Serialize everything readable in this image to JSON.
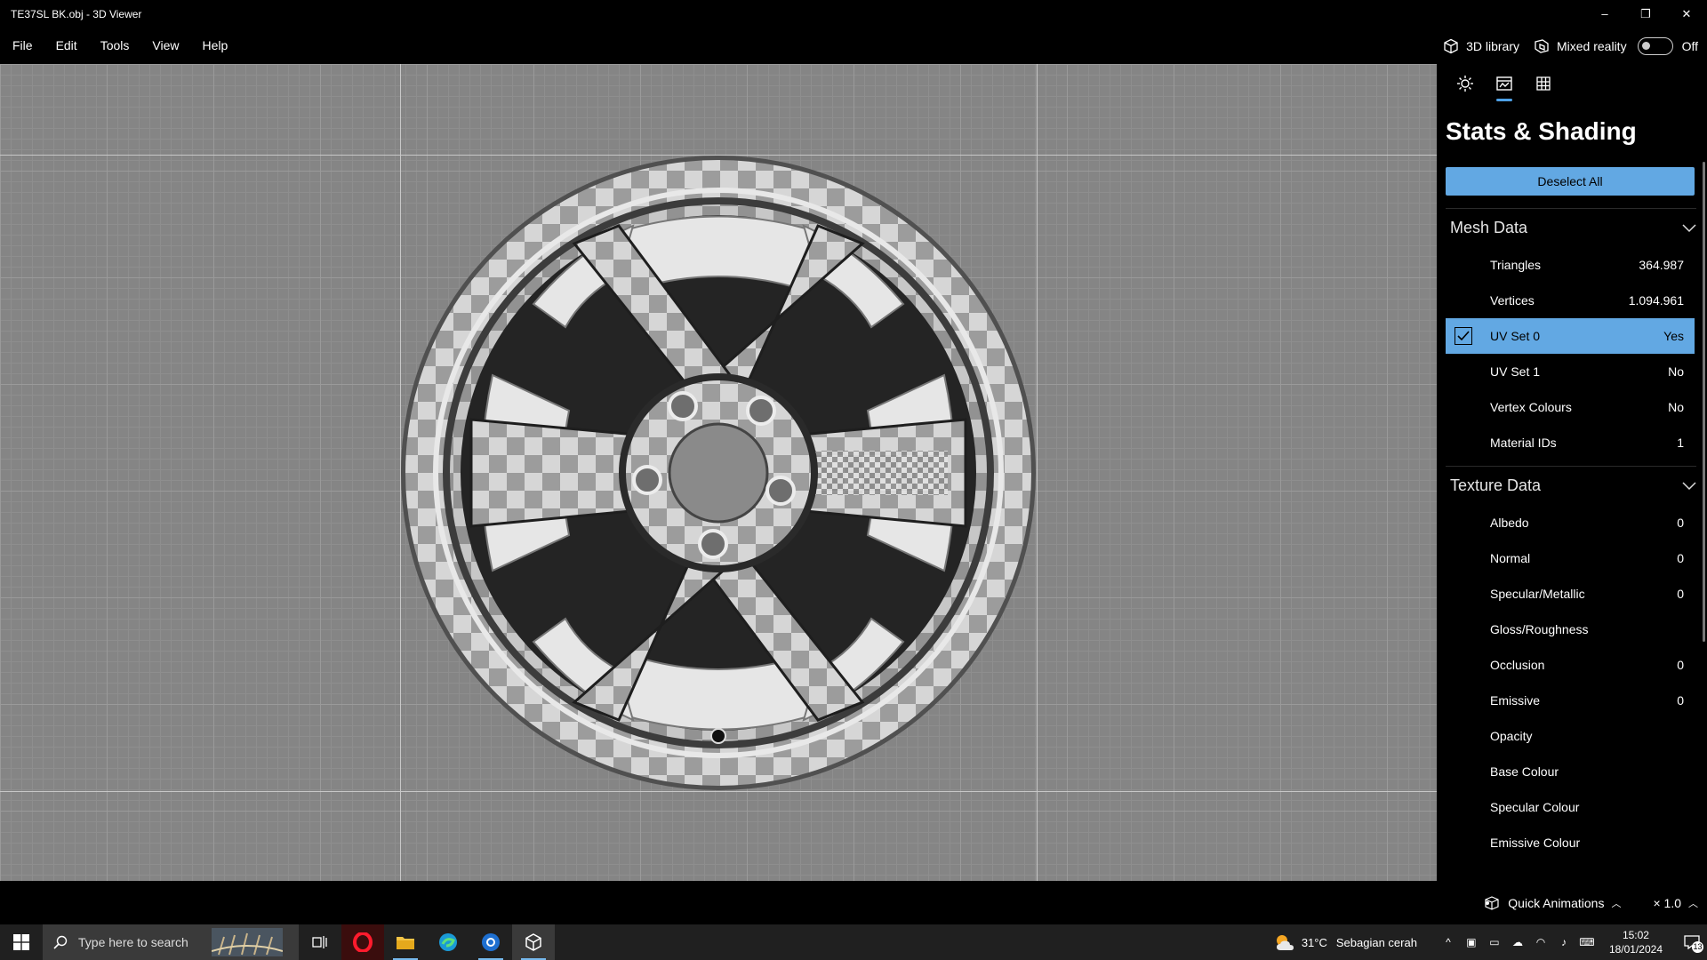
{
  "window": {
    "title": "TE37SL BK.obj - 3D Viewer",
    "controls": {
      "minimize": "–",
      "restore": "❐",
      "close": "✕"
    }
  },
  "menu": {
    "items": [
      "File",
      "Edit",
      "Tools",
      "View",
      "Help"
    ],
    "library": "3D library",
    "mixed_reality": "Mixed reality",
    "mixed_reality_state": "Off"
  },
  "panel": {
    "tabs": [
      "lighting-icon",
      "stats-shading-icon",
      "grid-icon"
    ],
    "active_tab": 1,
    "title": "Stats & Shading",
    "deselect": "Deselect All",
    "mesh": {
      "label": "Mesh Data",
      "rows": [
        {
          "label": "Triangles",
          "value": "364.987",
          "selected": false
        },
        {
          "label": "Vertices",
          "value": "1.094.961",
          "selected": false
        },
        {
          "label": "UV Set 0",
          "value": "Yes",
          "selected": true
        },
        {
          "label": "UV Set 1",
          "value": "No",
          "selected": false
        },
        {
          "label": "Vertex Colours",
          "value": "No",
          "selected": false
        },
        {
          "label": "Material IDs",
          "value": "1",
          "selected": false
        }
      ]
    },
    "texture": {
      "label": "Texture Data",
      "rows": [
        {
          "label": "Albedo",
          "value": "0"
        },
        {
          "label": "Normal",
          "value": "0"
        },
        {
          "label": "Specular/Metallic",
          "value": "0"
        },
        {
          "label": "Gloss/Roughness",
          "value": ""
        },
        {
          "label": "Occlusion",
          "value": "0"
        },
        {
          "label": "Emissive",
          "value": "0"
        },
        {
          "label": "Opacity",
          "value": ""
        },
        {
          "label": "Base Colour",
          "value": ""
        },
        {
          "label": "Specular Colour",
          "value": ""
        },
        {
          "label": "Emissive Colour",
          "value": ""
        }
      ]
    }
  },
  "status": {
    "quick_animations": "Quick Animations",
    "speed": "× 1.0"
  },
  "taskbar": {
    "search_placeholder": "Type here to search",
    "weather_temp": "31°C",
    "weather_text": "Sebagian cerah",
    "time": "15:02",
    "date": "18/01/2024",
    "notifications": "13"
  },
  "colors": {
    "accent": "#62a8e3",
    "viewport_bg": "#858585"
  }
}
